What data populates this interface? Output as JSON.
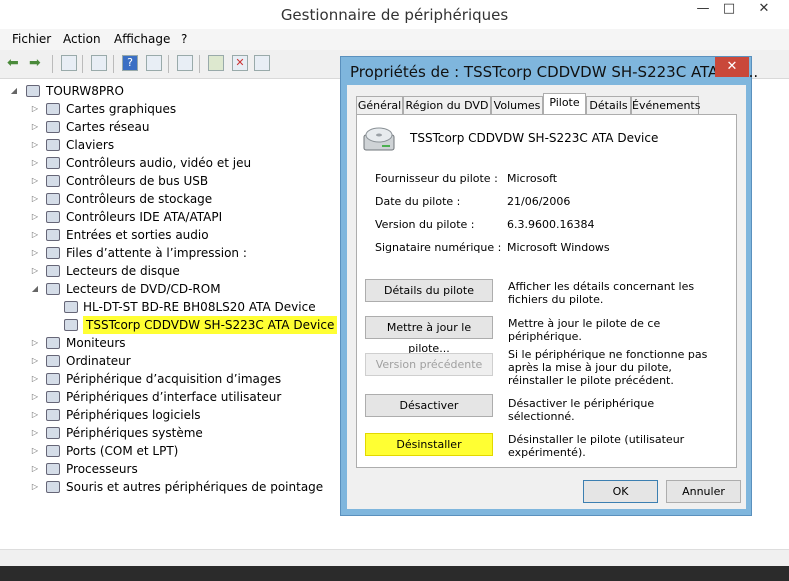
{
  "window": {
    "title": "Gestionnaire de périphériques",
    "min_glyph": "—",
    "max_glyph": "□",
    "close_glyph": "✕"
  },
  "menu": [
    "Fichier",
    "Action",
    "Affichage",
    "?"
  ],
  "toolbar_icons": [
    "back-icon",
    "forward-icon",
    "properties-icon",
    "help-icon",
    "help-book-icon",
    "show-hidden-icon",
    "scan-hardware-icon",
    "update-driver-icon",
    "disable-device-icon",
    "uninstall-device-icon"
  ],
  "tree": {
    "root": "TOURW8PRO",
    "expanded_arrow": "◢",
    "collapsed_arrow": "▷",
    "categories": [
      {
        "label": "Cartes graphiques",
        "icon": "display-adapter-icon"
      },
      {
        "label": "Cartes réseau",
        "icon": "network-adapter-icon"
      },
      {
        "label": "Claviers",
        "icon": "keyboard-icon"
      },
      {
        "label": "Contrôleurs audio, vidéo et jeu",
        "icon": "audio-icon"
      },
      {
        "label": "Contrôleurs de bus USB",
        "icon": "usb-icon"
      },
      {
        "label": "Contrôleurs de stockage",
        "icon": "storage-controller-icon"
      },
      {
        "label": "Contrôleurs IDE ATA/ATAPI",
        "icon": "ide-controller-icon"
      },
      {
        "label": "Entrées et sorties audio",
        "icon": "speaker-icon"
      },
      {
        "label": "Files d’attente à l’impression :",
        "icon": "printer-icon"
      },
      {
        "label": "Lecteurs de disque",
        "icon": "disk-drive-icon"
      },
      {
        "label": "Lecteurs de DVD/CD-ROM",
        "icon": "dvd-drive-icon"
      }
    ],
    "dvd_children": [
      {
        "label": "HL-DT-ST BD-RE  BH08LS20 ATA Device",
        "icon": "optical-drive-icon"
      },
      {
        "label": "TSSTcorp CDDVDW SH-S223C ATA Device",
        "icon": "optical-drive-icon",
        "highlighted": true
      }
    ],
    "categories_after": [
      {
        "label": "Moniteurs",
        "icon": "monitor-icon"
      },
      {
        "label": "Ordinateur",
        "icon": "computer-icon"
      },
      {
        "label": "Périphérique d’acquisition d’images",
        "icon": "camera-icon"
      },
      {
        "label": "Périphériques d’interface utilisateur",
        "icon": "hid-icon"
      },
      {
        "label": "Périphériques logiciels",
        "icon": "software-device-icon"
      },
      {
        "label": "Périphériques système",
        "icon": "system-device-icon"
      },
      {
        "label": "Ports (COM et LPT)",
        "icon": "port-icon"
      },
      {
        "label": "Processeurs",
        "icon": "processor-icon"
      },
      {
        "label": "Souris et autres périphériques de pointage",
        "icon": "mouse-icon"
      }
    ]
  },
  "dialog": {
    "title": "Propriétés de : TSSTcorp CDDVDW SH-S223C ATA De...",
    "close_glyph": "✕",
    "tabs": [
      "Général",
      "Région du DVD",
      "Volumes",
      "Pilote",
      "Détails",
      "Événements"
    ],
    "active_tab": "Pilote",
    "device_name": "TSSTcorp CDDVDW SH-S223C ATA Device",
    "info": [
      {
        "label": "Fournisseur du pilote :",
        "value": "Microsoft"
      },
      {
        "label": "Date du pilote :",
        "value": "21/06/2006"
      },
      {
        "label": "Version du pilote :",
        "value": "6.3.9600.16384"
      },
      {
        "label": "Signataire numérique :",
        "value": "Microsoft Windows"
      }
    ],
    "actions": [
      {
        "button": "Détails du pilote",
        "desc": "Afficher les détails concernant les fichiers du pilote."
      },
      {
        "button": "Mettre à jour le pilote...",
        "desc": "Mettre à jour le pilote de ce périphérique."
      },
      {
        "button": "Version précédente",
        "desc": "Si le périphérique ne fonctionne pas après la mise à jour du pilote, réinstaller le pilote précédent.",
        "disabled": true
      },
      {
        "button": "Désactiver",
        "desc": "Désactiver le périphérique sélectionné."
      },
      {
        "button": "Désinstaller",
        "desc": "Désinstaller le pilote (utilisateur expérimenté)."
      }
    ],
    "ok": "OK",
    "cancel": "Annuler"
  }
}
